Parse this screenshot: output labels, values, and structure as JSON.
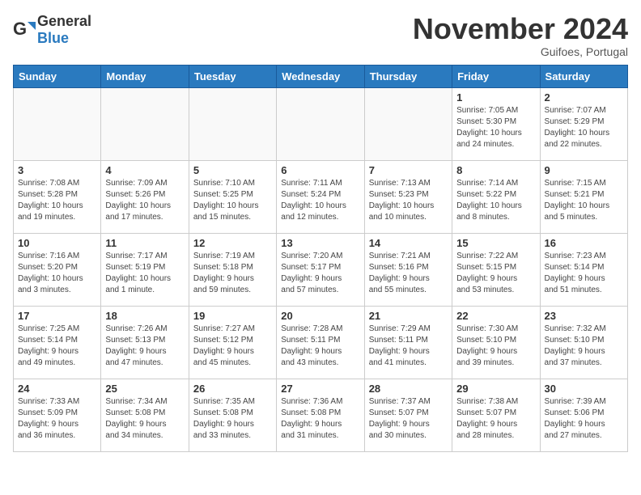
{
  "header": {
    "logo_general": "General",
    "logo_blue": "Blue",
    "month_title": "November 2024",
    "location": "Guifoes, Portugal"
  },
  "days_of_week": [
    "Sunday",
    "Monday",
    "Tuesday",
    "Wednesday",
    "Thursday",
    "Friday",
    "Saturday"
  ],
  "weeks": [
    [
      {
        "day": "",
        "info": ""
      },
      {
        "day": "",
        "info": ""
      },
      {
        "day": "",
        "info": ""
      },
      {
        "day": "",
        "info": ""
      },
      {
        "day": "",
        "info": ""
      },
      {
        "day": "1",
        "info": "Sunrise: 7:05 AM\nSunset: 5:30 PM\nDaylight: 10 hours\nand 24 minutes."
      },
      {
        "day": "2",
        "info": "Sunrise: 7:07 AM\nSunset: 5:29 PM\nDaylight: 10 hours\nand 22 minutes."
      }
    ],
    [
      {
        "day": "3",
        "info": "Sunrise: 7:08 AM\nSunset: 5:28 PM\nDaylight: 10 hours\nand 19 minutes."
      },
      {
        "day": "4",
        "info": "Sunrise: 7:09 AM\nSunset: 5:26 PM\nDaylight: 10 hours\nand 17 minutes."
      },
      {
        "day": "5",
        "info": "Sunrise: 7:10 AM\nSunset: 5:25 PM\nDaylight: 10 hours\nand 15 minutes."
      },
      {
        "day": "6",
        "info": "Sunrise: 7:11 AM\nSunset: 5:24 PM\nDaylight: 10 hours\nand 12 minutes."
      },
      {
        "day": "7",
        "info": "Sunrise: 7:13 AM\nSunset: 5:23 PM\nDaylight: 10 hours\nand 10 minutes."
      },
      {
        "day": "8",
        "info": "Sunrise: 7:14 AM\nSunset: 5:22 PM\nDaylight: 10 hours\nand 8 minutes."
      },
      {
        "day": "9",
        "info": "Sunrise: 7:15 AM\nSunset: 5:21 PM\nDaylight: 10 hours\nand 5 minutes."
      }
    ],
    [
      {
        "day": "10",
        "info": "Sunrise: 7:16 AM\nSunset: 5:20 PM\nDaylight: 10 hours\nand 3 minutes."
      },
      {
        "day": "11",
        "info": "Sunrise: 7:17 AM\nSunset: 5:19 PM\nDaylight: 10 hours\nand 1 minute."
      },
      {
        "day": "12",
        "info": "Sunrise: 7:19 AM\nSunset: 5:18 PM\nDaylight: 9 hours\nand 59 minutes."
      },
      {
        "day": "13",
        "info": "Sunrise: 7:20 AM\nSunset: 5:17 PM\nDaylight: 9 hours\nand 57 minutes."
      },
      {
        "day": "14",
        "info": "Sunrise: 7:21 AM\nSunset: 5:16 PM\nDaylight: 9 hours\nand 55 minutes."
      },
      {
        "day": "15",
        "info": "Sunrise: 7:22 AM\nSunset: 5:15 PM\nDaylight: 9 hours\nand 53 minutes."
      },
      {
        "day": "16",
        "info": "Sunrise: 7:23 AM\nSunset: 5:14 PM\nDaylight: 9 hours\nand 51 minutes."
      }
    ],
    [
      {
        "day": "17",
        "info": "Sunrise: 7:25 AM\nSunset: 5:14 PM\nDaylight: 9 hours\nand 49 minutes."
      },
      {
        "day": "18",
        "info": "Sunrise: 7:26 AM\nSunset: 5:13 PM\nDaylight: 9 hours\nand 47 minutes."
      },
      {
        "day": "19",
        "info": "Sunrise: 7:27 AM\nSunset: 5:12 PM\nDaylight: 9 hours\nand 45 minutes."
      },
      {
        "day": "20",
        "info": "Sunrise: 7:28 AM\nSunset: 5:11 PM\nDaylight: 9 hours\nand 43 minutes."
      },
      {
        "day": "21",
        "info": "Sunrise: 7:29 AM\nSunset: 5:11 PM\nDaylight: 9 hours\nand 41 minutes."
      },
      {
        "day": "22",
        "info": "Sunrise: 7:30 AM\nSunset: 5:10 PM\nDaylight: 9 hours\nand 39 minutes."
      },
      {
        "day": "23",
        "info": "Sunrise: 7:32 AM\nSunset: 5:10 PM\nDaylight: 9 hours\nand 37 minutes."
      }
    ],
    [
      {
        "day": "24",
        "info": "Sunrise: 7:33 AM\nSunset: 5:09 PM\nDaylight: 9 hours\nand 36 minutes."
      },
      {
        "day": "25",
        "info": "Sunrise: 7:34 AM\nSunset: 5:08 PM\nDaylight: 9 hours\nand 34 minutes."
      },
      {
        "day": "26",
        "info": "Sunrise: 7:35 AM\nSunset: 5:08 PM\nDaylight: 9 hours\nand 33 minutes."
      },
      {
        "day": "27",
        "info": "Sunrise: 7:36 AM\nSunset: 5:08 PM\nDaylight: 9 hours\nand 31 minutes."
      },
      {
        "day": "28",
        "info": "Sunrise: 7:37 AM\nSunset: 5:07 PM\nDaylight: 9 hours\nand 30 minutes."
      },
      {
        "day": "29",
        "info": "Sunrise: 7:38 AM\nSunset: 5:07 PM\nDaylight: 9 hours\nand 28 minutes."
      },
      {
        "day": "30",
        "info": "Sunrise: 7:39 AM\nSunset: 5:06 PM\nDaylight: 9 hours\nand 27 minutes."
      }
    ]
  ]
}
